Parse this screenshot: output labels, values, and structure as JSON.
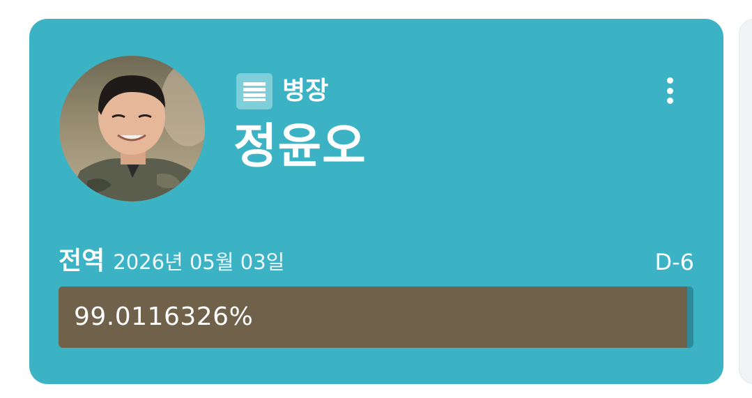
{
  "profile": {
    "rank": "병장",
    "rank_icon": "rank-stripes-icon",
    "name": "정윤오",
    "avatar": "soldier-portrait"
  },
  "discharge": {
    "label": "전역",
    "date": "2026년 05월 03일",
    "dday": "D-6"
  },
  "progress": {
    "text": "99.0116326%",
    "percent": 99.0116326
  },
  "menu": {
    "icon": "more-vertical-icon"
  },
  "colors": {
    "card": "#3cb2c5",
    "progress_fill": "#70614b",
    "progress_track": "#2e8a99",
    "rank_icon_bg": "#7fcfdb"
  }
}
